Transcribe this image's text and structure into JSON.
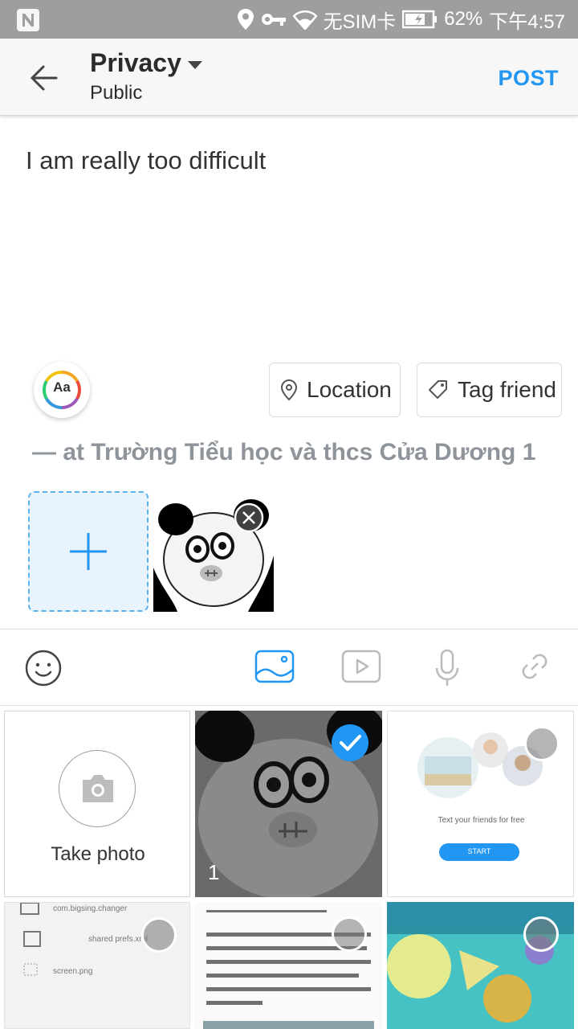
{
  "status_bar": {
    "carrier": "无SIM卡",
    "battery": "62%",
    "time": "下午4:57"
  },
  "header": {
    "title": "Privacy",
    "subtitle": "Public",
    "post_label": "POST"
  },
  "composer": {
    "text": "I am really too difficult",
    "font_button_label": "Aa",
    "location_label": "Location",
    "tag_friend_label": "Tag friend",
    "checkin_text": "— at Trường Tiểu học và thcs Cửa Dương 1"
  },
  "gallery": {
    "take_photo_label": "Take photo",
    "selected_index": "1",
    "invite_text": "Text your friends for free",
    "invite_button": "START",
    "settings_line1": "com.bigsing.changer",
    "settings_line2": "shared prefs.xml",
    "settings_line3": "screen.png"
  },
  "colors": {
    "accent": "#2196f3",
    "status_bar": "#9e9e9e",
    "checkin_text": "#8e949a"
  }
}
